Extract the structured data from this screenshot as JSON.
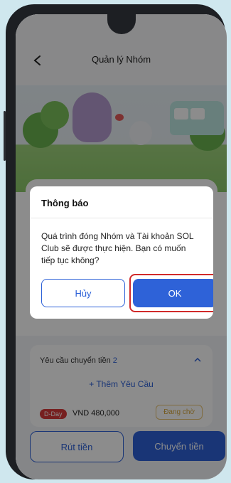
{
  "header": {
    "title": "Quản lý Nhóm",
    "back_icon": "chevron-left-icon"
  },
  "requests": {
    "title": "Yêu cầu chuyển tiền",
    "count": "2",
    "add_label": "+ Thêm Yêu Cầu",
    "item": {
      "badge": "D-Day",
      "amount": "VND 480,000",
      "status": "Đang chờ"
    }
  },
  "actions": {
    "withdraw_label": "Rút tiền",
    "transfer_label": "Chuyển tiền"
  },
  "dialog": {
    "title": "Thông báo",
    "message": "Quá trình đóng Nhóm và Tài khoản SOL Club sẽ được thực hiện. Bạn có muốn tiếp tục không?",
    "cancel_label": "Hủy",
    "ok_label": "OK"
  },
  "colors": {
    "primary": "#2e62d8",
    "highlight": "#d12a2a",
    "background": "#cfe7ee"
  }
}
